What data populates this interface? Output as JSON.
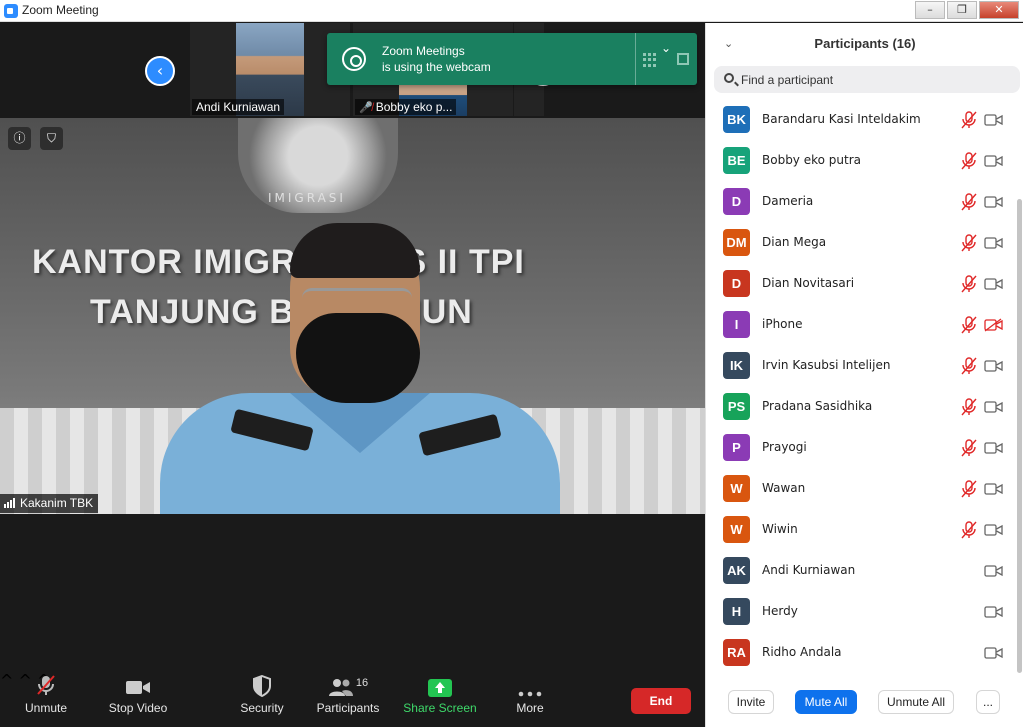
{
  "window": {
    "title": "Zoom Meeting",
    "minimize": "–",
    "restore": "❐",
    "close": "✕"
  },
  "thumbnails": [
    {
      "name": "Andi Kurniawan",
      "muted": false
    },
    {
      "name": "Bobby eko p...",
      "muted": true
    }
  ],
  "toast": {
    "line1": "Zoom Meetings",
    "line2": "is using the webcam"
  },
  "main_video": {
    "speaker": "Kakanim TBK",
    "sign_line1": "KANTOR IMIGR  KELAS II TPI",
    "sign_line2": "TANJUNG B    KARIMUN",
    "emblem_text": "IMIGRASI"
  },
  "toolbar": {
    "unmute": "Unmute",
    "stop_video": "Stop Video",
    "security": "Security",
    "participants": "Participants",
    "participants_count": "16",
    "share_screen": "Share Screen",
    "more": "More",
    "end": "End"
  },
  "panel": {
    "title": "Participants (16)",
    "search_placeholder": "Find a participant",
    "participants": [
      {
        "initials": "BK",
        "name": "Barandaru Kasi Inteldakim",
        "color": "#1e6fb8",
        "mic_muted": true,
        "video_off": false
      },
      {
        "initials": "BE",
        "name": "Bobby eko putra",
        "color": "#17a37a",
        "mic_muted": true,
        "video_off": false
      },
      {
        "initials": "D",
        "name": "Dameria",
        "color": "#8b3bb5",
        "mic_muted": true,
        "video_off": false
      },
      {
        "initials": "DM",
        "name": "Dian Mega",
        "color": "#d9560f",
        "mic_muted": true,
        "video_off": false
      },
      {
        "initials": "D",
        "name": "Dian Novitasari",
        "color": "#c8361f",
        "mic_muted": true,
        "video_off": false
      },
      {
        "initials": "I",
        "name": "iPhone",
        "color": "#8b3bb5",
        "mic_muted": true,
        "video_off": true
      },
      {
        "initials": "IK",
        "name": "Irvin Kasubsi Intelijen",
        "color": "#35495e",
        "mic_muted": true,
        "video_off": false
      },
      {
        "initials": "PS",
        "name": "Pradana Sasidhika",
        "color": "#17a35a",
        "mic_muted": true,
        "video_off": false
      },
      {
        "initials": "P",
        "name": "Prayogi",
        "color": "#8b3bb5",
        "mic_muted": true,
        "video_off": false
      },
      {
        "initials": "W",
        "name": "Wawan",
        "color": "#d9560f",
        "mic_muted": true,
        "video_off": false
      },
      {
        "initials": "W",
        "name": "Wiwin",
        "color": "#d9560f",
        "mic_muted": true,
        "video_off": false
      },
      {
        "initials": "AK",
        "name": "Andi Kurniawan",
        "color": "#35495e",
        "mic_muted": false,
        "video_off": false
      },
      {
        "initials": "H",
        "name": "Herdy",
        "color": "#35495e",
        "mic_muted": false,
        "video_off": false
      },
      {
        "initials": "RA",
        "name": "Ridho Andala",
        "color": "#c8361f",
        "mic_muted": false,
        "video_off": false
      }
    ],
    "footer": {
      "invite": "Invite",
      "mute_all": "Mute All",
      "unmute_all": "Unmute All",
      "more": "..."
    }
  }
}
